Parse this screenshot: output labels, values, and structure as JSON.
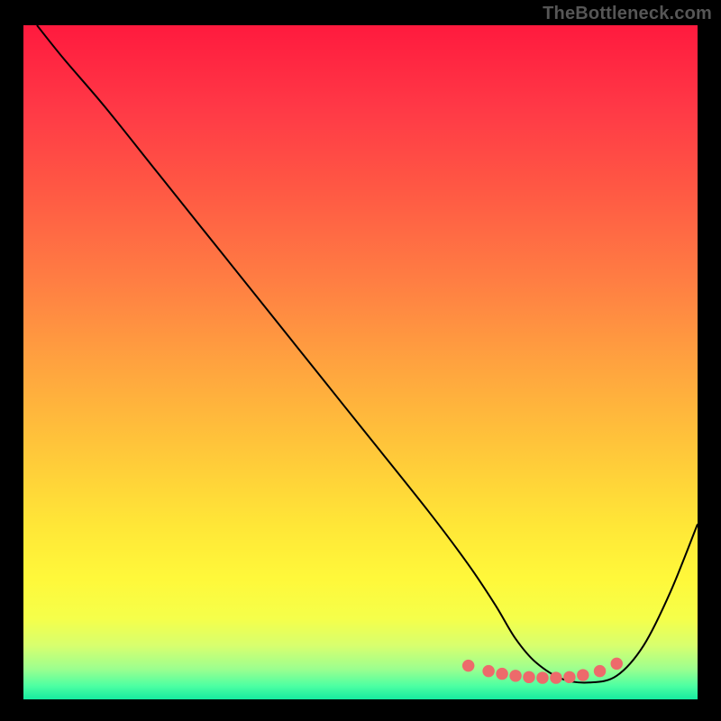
{
  "watermark": "TheBottleneck.com",
  "gradient_stops": [
    {
      "offset": 0.0,
      "color": "#ff1a3e"
    },
    {
      "offset": 0.12,
      "color": "#ff3846"
    },
    {
      "offset": 0.25,
      "color": "#ff5a44"
    },
    {
      "offset": 0.38,
      "color": "#ff7e43"
    },
    {
      "offset": 0.5,
      "color": "#ffa23f"
    },
    {
      "offset": 0.62,
      "color": "#ffc43a"
    },
    {
      "offset": 0.74,
      "color": "#ffe637"
    },
    {
      "offset": 0.82,
      "color": "#fff83a"
    },
    {
      "offset": 0.88,
      "color": "#f5ff4a"
    },
    {
      "offset": 0.92,
      "color": "#d8ff6e"
    },
    {
      "offset": 0.955,
      "color": "#9cff8f"
    },
    {
      "offset": 0.98,
      "color": "#4dffa2"
    },
    {
      "offset": 1.0,
      "color": "#16eba0"
    }
  ],
  "chart_data": {
    "type": "line",
    "title": "",
    "xlabel": "",
    "ylabel": "",
    "xlim": [
      0,
      100
    ],
    "ylim": [
      0,
      100
    ],
    "grid": false,
    "legend": false,
    "series": [
      {
        "name": "bottleneck-curve",
        "x": [
          2,
          6,
          12,
          20,
          30,
          40,
          50,
          60,
          66,
          70,
          73,
          76,
          80,
          84,
          88,
          92,
          96,
          100
        ],
        "y": [
          100,
          95,
          88,
          78,
          65.5,
          53,
          40.5,
          28,
          20,
          14,
          9,
          5.5,
          3,
          2.5,
          3.5,
          8,
          16,
          26
        ]
      },
      {
        "name": "highlight-dots",
        "x": [
          66,
          69,
          71,
          73,
          75,
          77,
          79,
          81,
          83,
          85.5,
          88
        ],
        "y": [
          5,
          4.2,
          3.8,
          3.5,
          3.3,
          3.2,
          3.2,
          3.3,
          3.6,
          4.2,
          5.3
        ]
      }
    ],
    "annotations": []
  }
}
